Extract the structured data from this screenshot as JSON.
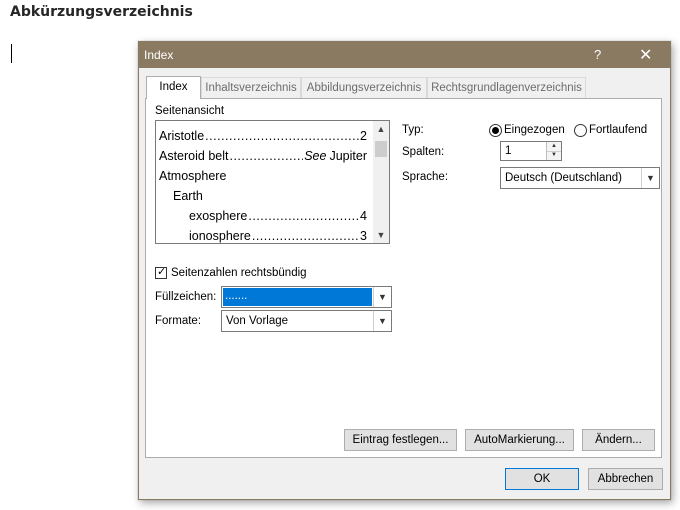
{
  "document": {
    "heading": "Abkürzungsverzeichnis"
  },
  "dialog": {
    "title": "Index",
    "help_label": "?",
    "close_label": "✕",
    "tabs": [
      {
        "label": "Index",
        "active": true
      },
      {
        "label": "Inhaltsverzeichnis",
        "active": false
      },
      {
        "label": "Abbildungsverzeichnis",
        "active": false
      },
      {
        "label": "Rechtsgrundlagenverzeichnis",
        "active": false
      }
    ],
    "preview": {
      "label": "Seitenansicht",
      "lines": [
        {
          "text": "Aristotle",
          "page": "2"
        },
        {
          "text": "Asteroid belt",
          "see": "See",
          "page": "Jupiter"
        },
        {
          "text": "Atmosphere",
          "page": ""
        },
        {
          "text": "Earth",
          "page": ""
        },
        {
          "text": "exosphere",
          "page": "4"
        },
        {
          "text": "ionosphere",
          "page": "3"
        }
      ]
    },
    "typ": {
      "label": "Typ:",
      "options": [
        {
          "label": "Eingezogen",
          "selected": true
        },
        {
          "label": "Fortlaufend",
          "selected": false
        }
      ]
    },
    "spalten": {
      "label": "Spalten:",
      "value": "1"
    },
    "sprache": {
      "label": "Sprache:",
      "value": "Deutsch (Deutschland)"
    },
    "right_align": {
      "label": "Seitenzahlen rechtsbündig",
      "checked": true
    },
    "fuellzeichen": {
      "label": "Füllzeichen:",
      "value": "......."
    },
    "formate": {
      "label": "Formate:",
      "value": "Von Vorlage"
    },
    "buttons": {
      "mark_entry": "Eintrag festlegen...",
      "automark": "AutoMarkierung...",
      "modify": "Ändern...",
      "ok": "OK",
      "cancel": "Abbrechen"
    }
  },
  "colors": {
    "titlebar": "#8a7a62",
    "selection": "#0078d7"
  },
  "icons": {
    "close": "close-icon",
    "help": "help-icon",
    "dropdown": "chevron-down-icon",
    "scroll_up": "chevron-up-icon",
    "scroll_down": "chevron-down-icon"
  }
}
